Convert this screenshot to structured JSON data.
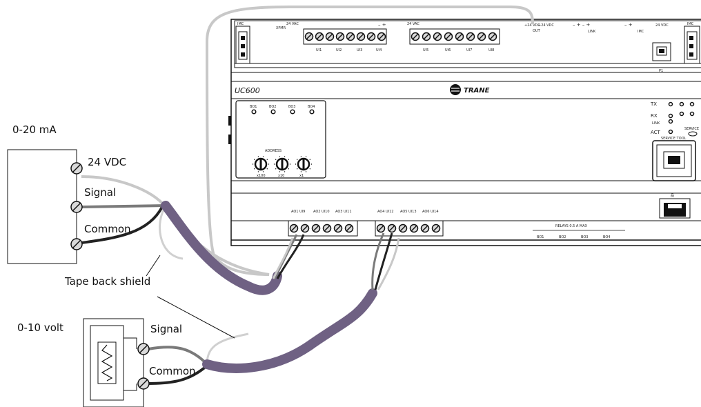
{
  "sensor_a": {
    "title": "0-20 mA",
    "terminal_24vdc": "24 VDC",
    "terminal_signal": "Signal",
    "terminal_common": "Common"
  },
  "sensor_b": {
    "title": "0-10 volt",
    "terminal_signal": "Signal",
    "terminal_common": "Common"
  },
  "annotation": "Tape back shield",
  "controller": {
    "model": "UC600",
    "brand": "TRANE",
    "top_left_connector": "IMC",
    "top_right_connector": "IMC",
    "xfmr_label": "XFMR",
    "vac_labels": [
      "24 VAC",
      "24 VAC"
    ],
    "ui_top_left": [
      "UI1",
      "UI2",
      "UI3",
      "UI4"
    ],
    "ui_top_right": [
      "UI5",
      "UI6",
      "UI7",
      "UI8"
    ],
    "out_24vdc": [
      "+24 VDC",
      "+24 VDC"
    ],
    "out_label": "OUT",
    "link_label": "LINK",
    "imc_label": "IMC",
    "vdc_label": "24 VDC",
    "p1_label": "P1",
    "bo_leds": [
      "BO1",
      "BO2",
      "BO3",
      "BO4"
    ],
    "address_label": "ADDRESS",
    "dial_labels": [
      "x100",
      "x10",
      "x1"
    ],
    "status_leds": [
      "TX",
      "RX",
      "ACT"
    ],
    "link_status": "LINK",
    "service_label": "SERVICE",
    "service_tool_label": "SERVICE TOOL",
    "bottom_left_ao": [
      "AO1 UI9",
      "AO2 UI10",
      "AO3 UI11"
    ],
    "bottom_mid_ao": [
      "AO4 UI12",
      "AO5 UI13",
      "AO6 UI14"
    ],
    "relays_label": "RELAYS 0.5 A MAX",
    "relay_bo": [
      "BO1",
      "BO2",
      "BO3",
      "BO4"
    ]
  }
}
